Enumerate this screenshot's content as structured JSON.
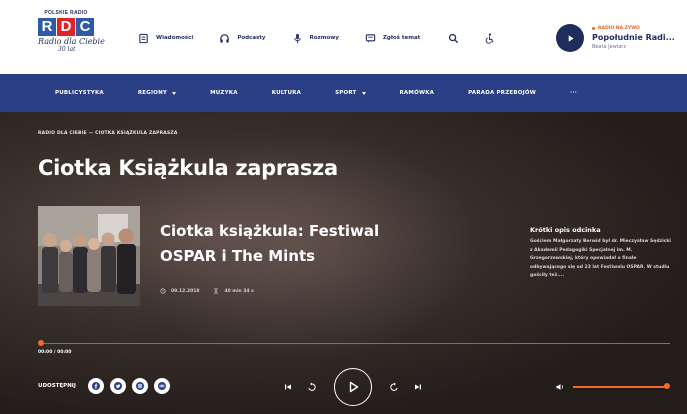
{
  "header": {
    "logo": {
      "top_text": "POLSKIE RADIO",
      "letters": [
        "R",
        "D",
        "C"
      ],
      "script": "Radio dla Ciebie",
      "years": "30 lat"
    },
    "nav": [
      {
        "label": "Wiadomości",
        "icon": "document-icon"
      },
      {
        "label": "Podcasty",
        "icon": "headphones-icon"
      },
      {
        "label": "Rozmowy",
        "icon": "microphone-icon"
      },
      {
        "label": "Zgłoś temat",
        "icon": "chat-icon"
      }
    ],
    "search_icon": "search-icon",
    "accessibility_icon": "accessibility-icon",
    "live": {
      "label": "RADIO NA ŻYWO",
      "title": "Popołudnie Radi...",
      "host": "Beata Jewiarz"
    }
  },
  "mainnav": {
    "items": [
      {
        "label": "PUBLICYSTYKA",
        "dropdown": false
      },
      {
        "label": "REGIONY",
        "dropdown": true
      },
      {
        "label": "MUZYKA",
        "dropdown": false
      },
      {
        "label": "KULTURA",
        "dropdown": false
      },
      {
        "label": "SPORT",
        "dropdown": true
      },
      {
        "label": "RAMÓWKA",
        "dropdown": false
      },
      {
        "label": "PARADA PRZEBOJÓW",
        "dropdown": false
      },
      {
        "label": "···",
        "dropdown": false
      }
    ]
  },
  "hero": {
    "breadcrumb": "RADIO DLA CIEBIE  —  CIOTKA KSIĄŻKULA ZAPRASZA",
    "page_title": "Ciotka Książkula zaprasza",
    "episode": {
      "title": "Ciotka książkula: Festiwal OSPAR i The Mints",
      "date": "09.12.2018",
      "duration": "40 min 34 s"
    },
    "description": {
      "heading": "Krótki opis odcinka",
      "body": "Gościem Małgorzaty Berwid był dr. Mieczysław Sędzicki z Akademii Pedagogiki Specjalnej im. M. Grzegorzewskiej, który opowiadał o finale odbywającego się od 23 lat Festiwalu OSPAR. W studiu gościły też...."
    }
  },
  "player": {
    "time": "00:00 / 00:00",
    "progress": 0,
    "volume": 1,
    "share_label": "UDOSTĘPNIJ",
    "share_buttons": [
      "facebook-icon",
      "twitter-icon",
      "instagram-icon",
      "link-icon"
    ]
  },
  "colors": {
    "navy": "#1f2d5c",
    "nav_blue": "#2b3f86",
    "accent": "#ef6a2b"
  }
}
